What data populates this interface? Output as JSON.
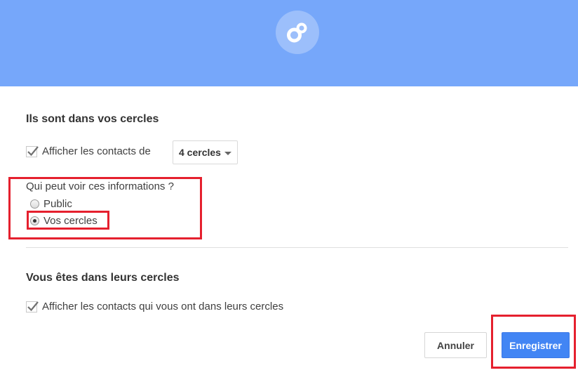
{
  "colors": {
    "header_bg": "#76a7fa",
    "primary_button": "#4285f4",
    "highlight_box": "#e5202e"
  },
  "header": {
    "logo_icon": "circles-icon"
  },
  "circles_section": {
    "title": "Ils sont dans vos cercles",
    "show_contacts_label": "Afficher les contacts de",
    "show_contacts_checked": true,
    "circles_dropdown_value": "4 cercles",
    "visibility_question": "Qui peut voir ces informations ?",
    "visibility_options": [
      {
        "label": "Public",
        "selected": false
      },
      {
        "label": "Vos cercles",
        "selected": true
      }
    ]
  },
  "their_circles_section": {
    "title": "Vous êtes dans leurs cercles",
    "show_contacts_label": "Afficher les contacts qui vous ont dans leurs cercles",
    "show_contacts_checked": true
  },
  "actions": {
    "cancel_label": "Annuler",
    "save_label": "Enregistrer"
  }
}
